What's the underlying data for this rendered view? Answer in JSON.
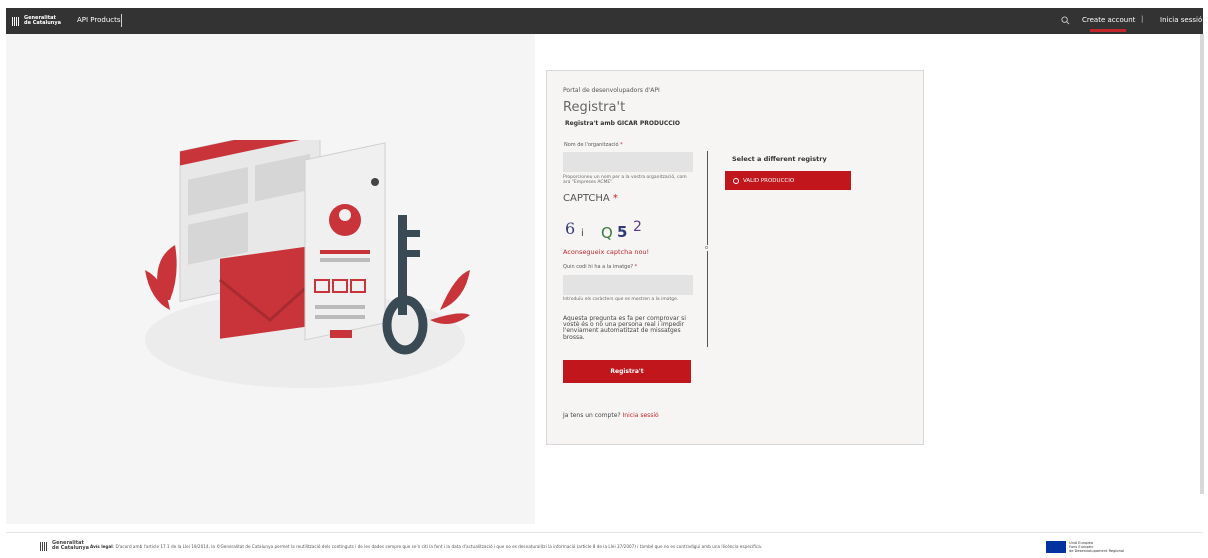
{
  "header": {
    "logo_line1": "Generalitat",
    "logo_line2": "de Catalunya",
    "api_products": "API Products",
    "search_icon": "search-icon",
    "create_account": "Create account",
    "separator": "|",
    "login": "Inicia sessió",
    "accent_color": "#c0262c"
  },
  "form": {
    "portal_title": "Portal de desenvolupadors d'API",
    "title": "Registra't",
    "subtitle": "Registra't amb GICAR PRODUCCIO",
    "org_label": "Nom de l'organització",
    "org_value": "",
    "org_help": "Proporcioneu un nom per a la vostra organització, com ara \"Empreses ACME\".",
    "captcha_title": "CAPTCHA",
    "captcha_chars": [
      "6",
      "i",
      "Q",
      "5",
      "2"
    ],
    "new_captcha": "Aconsegueix captcha nou!",
    "code_label": "Quin codi hi ha a la imatge?",
    "code_value": "",
    "code_help": "Introduïu els caràcters que es mostren a la imatge.",
    "captcha_desc": "Aquesta pregunta es fa per comprovar si vostè és o no una persona real i impedir l'enviament automatitzat de missatges brossa.",
    "or_text": "o",
    "submit": "Registra't",
    "have_account": "Ja tens un compte?",
    "login_link": "Inicia sessió",
    "required_mark": "*"
  },
  "registry": {
    "title": "Select a different registry",
    "valid_button": "VALID PRODUCCIO"
  },
  "footer": {
    "logo_line1": "Generalitat",
    "logo_line2": "de Catalunya",
    "legal_label": "Avís legal",
    "legal_text": ": D'acord amb l'article 17.1 de la Llei 19/2014, la ©Generalitat de Catalunya permet la reutilització dels continguts i de les dades sempre que se'n citi la font i la data d'actualització i que no es desnaturalitzi la informació (article 8 de la Llei 37/2007) i també que no es contradigui amb una llicència específica.",
    "eu_line1": "Unió Europea",
    "eu_line2": "Fons Europeu",
    "eu_line3": "de Desenvolupament Regional"
  }
}
